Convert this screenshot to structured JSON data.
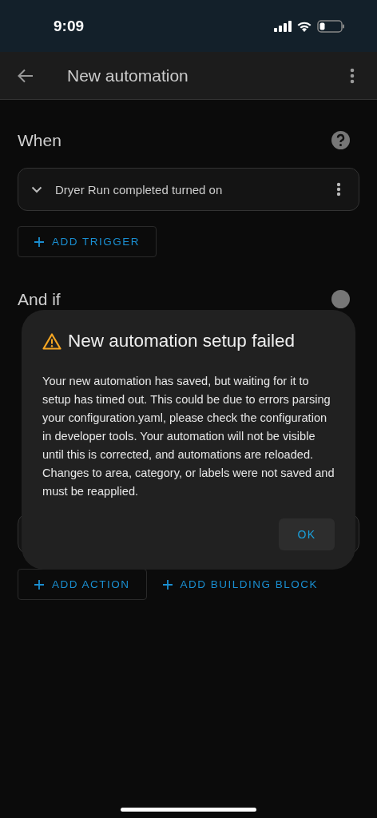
{
  "status_bar": {
    "time": "9:09"
  },
  "app_bar": {
    "title": "New automation"
  },
  "when": {
    "heading": "When",
    "triggers": [
      {
        "label": "Dryer Run completed turned on",
        "expanded": false
      }
    ],
    "add_button": "ADD TRIGGER"
  },
  "and_if": {
    "heading": "And if"
  },
  "then": {
    "buttons": [
      {
        "label": "ADD ACTION",
        "kind": "outlined"
      },
      {
        "label": "ADD BUILDING BLOCK",
        "kind": "text"
      }
    ]
  },
  "dialog": {
    "title": "New automation setup failed",
    "body": "Your new automation has saved, but waiting for it to setup has timed out. This could be due to errors parsing your configuration.yaml, please check the configuration in developer tools. Your automation will not be visible until this is corrected, and automations are reloaded. Changes to area, category, or labels were not saved and must be reapplied.",
    "button": "OK"
  }
}
